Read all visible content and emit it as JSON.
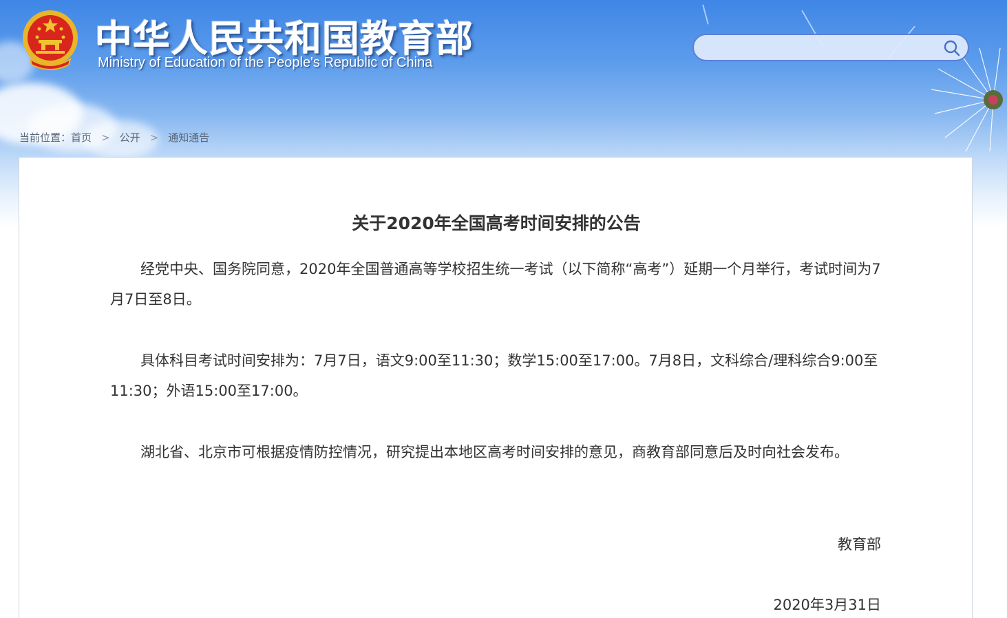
{
  "header": {
    "title_cn": "中华人民共和国教育部",
    "title_en": "Ministry of Education of the People's Republic of China",
    "emblem_icon": "national-emblem-icon"
  },
  "search": {
    "placeholder": "",
    "icon": "search-icon"
  },
  "breadcrumb": {
    "prefix": "当前位置：",
    "items": [
      "首页",
      "公开",
      "通知通告"
    ],
    "separator": ">"
  },
  "article": {
    "title": "关于2020年全国高考时间安排的公告",
    "paragraphs": [
      "经党中央、国务院同意，2020年全国普通高等学校招生统一考试（以下简称“高考”）延期一个月举行，考试时间为7月7日至8日。",
      "具体科目考试时间安排为：7月7日，语文9:00至11:30；数学15:00至17:00。7月8日，文科综合/理科综合9:00至11:30；外语15:00至17:00。",
      "湖北省、北京市可根据疫情防控情况，研究提出本地区高考时间安排的意见，商教育部同意后及时向社会发布。"
    ],
    "issuer": "教育部",
    "date": "2020年3月31日"
  },
  "colors": {
    "sky_top": "#3f86e6",
    "search_border": "#5b7fd6",
    "text": "#333333",
    "breadcrumb_text": "#5a6878",
    "emblem_red": "#d8261d",
    "emblem_gold": "#f2c230"
  }
}
